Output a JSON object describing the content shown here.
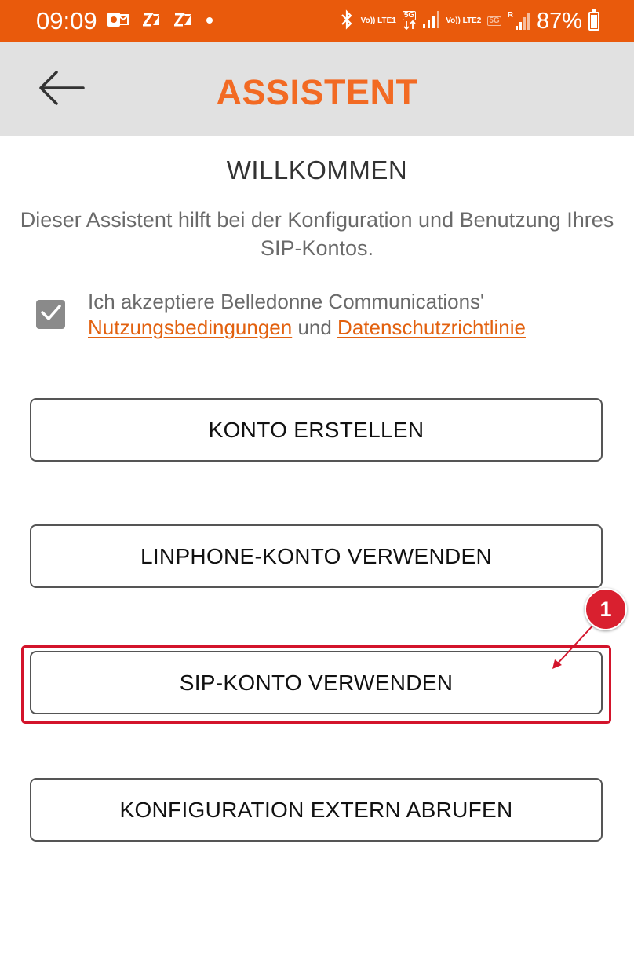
{
  "status_bar": {
    "time": "09:09",
    "battery_percent": "87%",
    "battery_level": 0.87,
    "sim1_label": "Vo)) LTE1",
    "sim2_label": "Vo)) LTE2",
    "net1": "5G",
    "net2": "5G",
    "roaming": "R",
    "icons": [
      "outlook-icon",
      "zendesk-icon",
      "zendesk-icon",
      "dot-icon",
      "bluetooth-icon",
      "signal-icon",
      "signal-icon",
      "battery-icon"
    ]
  },
  "appbar": {
    "title": "ASSISTENT",
    "back_icon": "arrow-left-icon"
  },
  "main": {
    "heading": "WILLKOMMEN",
    "description": "Dieser Assistent hilft bei der Konfiguration und Benutzung Ihres SIP-Kontos.",
    "terms": {
      "checked": true,
      "prefix": "Ich akzeptiere Belledonne Communications'",
      "link1": "Nutzungsbedingungen",
      "connector": " und ",
      "link2": "Datenschutzrichtlinie"
    },
    "buttons": [
      {
        "label": "KONTO ERSTELLEN"
      },
      {
        "label": "LINPHONE-KONTO VERWENDEN"
      },
      {
        "label": "SIP-KONTO VERWENDEN"
      },
      {
        "label": "KONFIGURATION EXTERN ABRUFEN"
      }
    ]
  },
  "annotation": {
    "marker_number": "1",
    "color": "#d3142b"
  },
  "colors": {
    "status_bar": "#e95a0c",
    "accent": "#f26a23",
    "appbar_bg": "#e1e1e1"
  }
}
